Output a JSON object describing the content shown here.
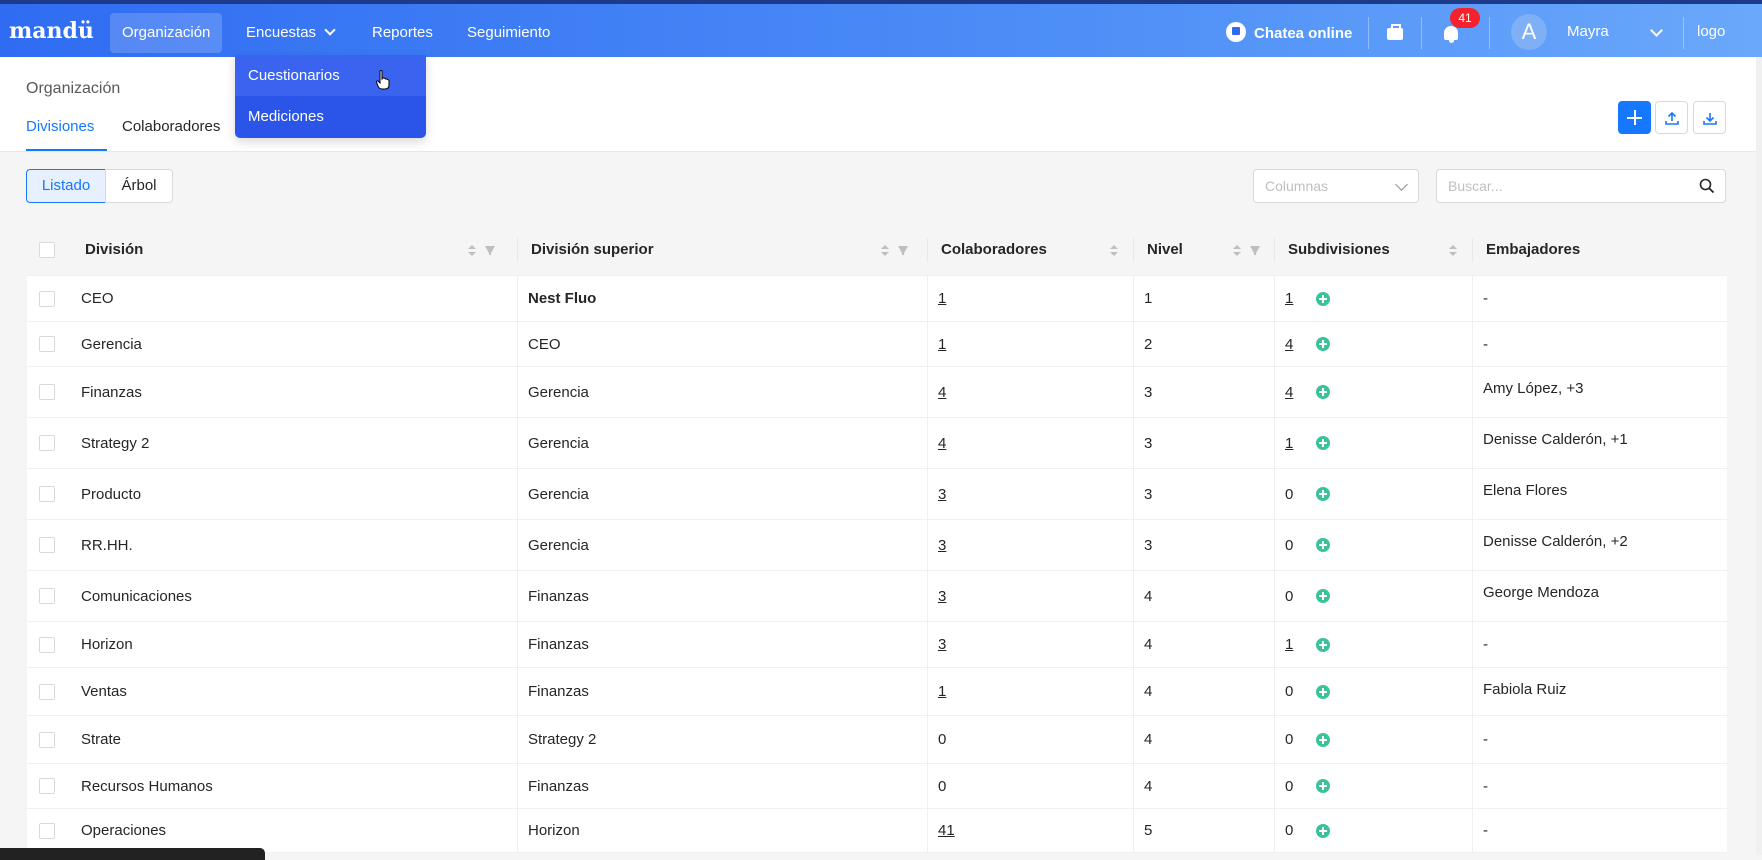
{
  "brand": "mandü",
  "nav": {
    "items": [
      {
        "label": "Organización",
        "active": true
      },
      {
        "label": "Encuestas",
        "active": false,
        "dropdown": true
      },
      {
        "label": "Reportes",
        "active": false
      },
      {
        "label": "Seguimiento",
        "active": false
      }
    ],
    "chat_label": "Chatea online",
    "notifications": "41",
    "avatar_initial": "A",
    "user_name": "Mayra",
    "logo_alt": "logo"
  },
  "dropdown": {
    "items": [
      "Cuestionarios",
      "Mediciones"
    ]
  },
  "page": {
    "title": "Organización",
    "tabs": [
      "Divisiones",
      "Colaboradores"
    ],
    "active_tab": "Divisiones"
  },
  "view_toggle": {
    "list": "Listado",
    "tree": "Árbol",
    "selected": "Listado"
  },
  "columns_select": {
    "placeholder": "Columnas"
  },
  "search": {
    "placeholder": "Buscar..."
  },
  "table": {
    "headers": [
      "División",
      "División superior",
      "Colaboradores",
      "Nivel",
      "Subdivisiones",
      "Embajadores"
    ],
    "rows": [
      {
        "division": "CEO",
        "superior": "Nest Fluo",
        "colaboradores": "1",
        "nivel": "1",
        "subdivisiones": "1",
        "embajadores": "-"
      },
      {
        "division": "Gerencia",
        "superior": "CEO",
        "colaboradores": "1",
        "nivel": "2",
        "subdivisiones": "4",
        "embajadores": "-"
      },
      {
        "division": "Finanzas",
        "superior": "Gerencia",
        "colaboradores": "4",
        "nivel": "3",
        "subdivisiones": "4",
        "embajadores": "Amy López, +3"
      },
      {
        "division": "Strategy 2",
        "superior": "Gerencia",
        "colaboradores": "4",
        "nivel": "3",
        "subdivisiones": "1",
        "embajadores": "Denisse Calderón, +1"
      },
      {
        "division": "Producto",
        "superior": "Gerencia",
        "colaboradores": "3",
        "nivel": "3",
        "subdivisiones": "0",
        "embajadores": "Elena Flores"
      },
      {
        "division": "RR.HH.",
        "superior": "Gerencia",
        "colaboradores": "3",
        "nivel": "3",
        "subdivisiones": "0",
        "embajadores": "Denisse Calderón, +2"
      },
      {
        "division": "Comunicaciones",
        "superior": "Finanzas",
        "colaboradores": "3",
        "nivel": "4",
        "subdivisiones": "0",
        "embajadores": "George Mendoza"
      },
      {
        "division": "Horizon",
        "superior": "Finanzas",
        "colaboradores": "3",
        "nivel": "4",
        "subdivisiones": "1",
        "embajadores": "-"
      },
      {
        "division": "Ventas",
        "superior": "Finanzas",
        "colaboradores": "1",
        "nivel": "4",
        "subdivisiones": "0",
        "embajadores": "Fabiola Ruiz"
      },
      {
        "division": "Strate",
        "superior": "Strategy 2",
        "colaboradores": "0",
        "nivel": "4",
        "subdivisiones": "0",
        "embajadores": "-"
      },
      {
        "division": "Recursos Humanos",
        "superior": "Finanzas",
        "colaboradores": "0",
        "nivel": "4",
        "subdivisiones": "0",
        "embajadores": "-"
      },
      {
        "division": "Operaciones",
        "superior": "Horizon",
        "colaboradores": "41",
        "nivel": "5",
        "subdivisiones": "0",
        "embajadores": "-"
      }
    ]
  }
}
